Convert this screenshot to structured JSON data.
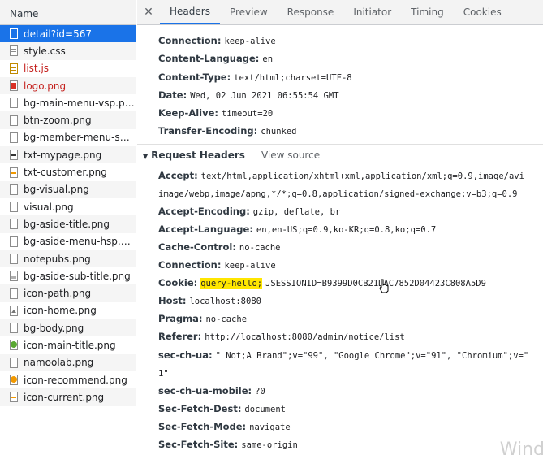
{
  "list": {
    "header": "Name",
    "items": [
      {
        "name": "detail?id=567",
        "icon": "document-icon",
        "selected": true
      },
      {
        "name": "style.css",
        "icon": "css-file-icon"
      },
      {
        "name": "list.js",
        "icon": "js-file-icon",
        "error": true
      },
      {
        "name": "logo.png",
        "icon": "image-icon",
        "error": true
      },
      {
        "name": "bg-main-menu-vsp.png",
        "icon": "image-icon"
      },
      {
        "name": "btn-zoom.png",
        "icon": "image-icon"
      },
      {
        "name": "bg-member-menu-sp....",
        "icon": "image-icon"
      },
      {
        "name": "txt-mypage.png",
        "icon": "image-icon"
      },
      {
        "name": "txt-customer.png",
        "icon": "image-icon"
      },
      {
        "name": "bg-visual.png",
        "icon": "image-icon"
      },
      {
        "name": "visual.png",
        "icon": "image-icon"
      },
      {
        "name": "bg-aside-title.png",
        "icon": "image-icon"
      },
      {
        "name": "bg-aside-menu-hsp.png",
        "icon": "image-icon"
      },
      {
        "name": "notepubs.png",
        "icon": "image-icon"
      },
      {
        "name": "bg-aside-sub-title.png",
        "icon": "image-icon"
      },
      {
        "name": "icon-path.png",
        "icon": "image-icon"
      },
      {
        "name": "icon-home.png",
        "icon": "image-icon"
      },
      {
        "name": "bg-body.png",
        "icon": "image-icon"
      },
      {
        "name": "icon-main-title.png",
        "icon": "image-icon"
      },
      {
        "name": "namoolab.png",
        "icon": "image-icon"
      },
      {
        "name": "icon-recommend.png",
        "icon": "image-icon"
      },
      {
        "name": "icon-current.png",
        "icon": "image-icon"
      }
    ]
  },
  "tabs": {
    "close": "✕",
    "items": [
      "Headers",
      "Preview",
      "Response",
      "Initiator",
      "Timing",
      "Cookies"
    ],
    "active": "Headers"
  },
  "response_headers": [
    {
      "key": "Connection:",
      "value": "keep-alive"
    },
    {
      "key": "Content-Language:",
      "value": "en"
    },
    {
      "key": "Content-Type:",
      "value": "text/html;charset=UTF-8"
    },
    {
      "key": "Date:",
      "value": "Wed, 02 Jun 2021 06:55:54 GMT"
    },
    {
      "key": "Keep-Alive:",
      "value": "timeout=20"
    },
    {
      "key": "Transfer-Encoding:",
      "value": "chunked"
    }
  ],
  "request_section": {
    "title": "Request Headers",
    "view_source": "View source"
  },
  "request_headers": {
    "accept_key": "Accept:",
    "accept_value": "text/html,application/xhtml+xml,application/xml;q=0.9,image/avi",
    "accept_cont": "image/webp,image/apng,*/*;q=0.8,application/signed-exchange;v=b3;q=0.9",
    "accept_encoding_key": "Accept-Encoding:",
    "accept_encoding_value": "gzip, deflate, br",
    "accept_language_key": "Accept-Language:",
    "accept_language_value": "en,en-US;q=0.9,ko-KR;q=0.8,ko;q=0.7",
    "cache_control_key": "Cache-Control:",
    "cache_control_value": "no-cache",
    "connection_key": "Connection:",
    "connection_value": "keep-alive",
    "cookie_key": "Cookie:",
    "cookie_highlight": "query-hello;",
    "cookie_rest": "JSESSIONID=B9399D0CB21DAC7852D04423C808A5D9",
    "host_key": "Host:",
    "host_value": "localhost:8080",
    "pragma_key": "Pragma:",
    "pragma_value": "no-cache",
    "referer_key": "Referer:",
    "referer_value": "http://localhost:8080/admin/notice/list",
    "sec_ch_ua_key": "sec-ch-ua:",
    "sec_ch_ua_value": "\" Not;A Brand\";v=\"99\", \"Google Chrome\";v=\"91\", \"Chromium\";v=\"",
    "sec_ch_ua_cont": "1\"",
    "sec_ch_ua_mobile_key": "sec-ch-ua-mobile:",
    "sec_ch_ua_mobile_value": "?0",
    "sec_fetch_dest_key": "Sec-Fetch-Dest:",
    "sec_fetch_dest_value": "document",
    "sec_fetch_mode_key": "Sec-Fetch-Mode:",
    "sec_fetch_mode_value": "navigate",
    "sec_fetch_site_key": "Sec-Fetch-Site:",
    "sec_fetch_site_value": "same-origin"
  },
  "watermark": "Wind",
  "colors": {
    "selected_row": "#1a73e8",
    "error_text": "#c5221f",
    "highlight": "#ffe600"
  }
}
